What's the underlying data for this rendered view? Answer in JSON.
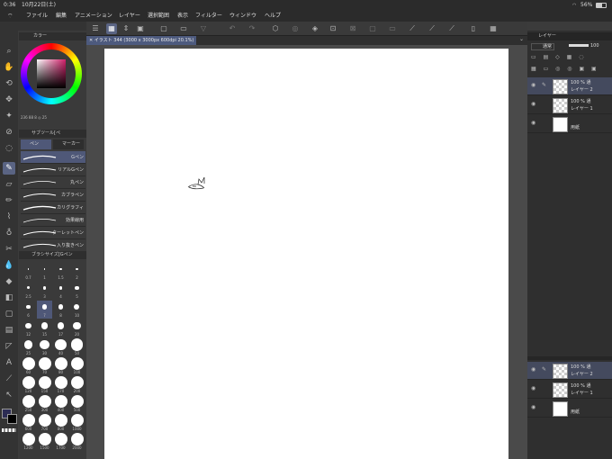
{
  "status": {
    "time": "0:36",
    "date": "10月22日(土)",
    "battery": "56%"
  },
  "menu": [
    "ファイル",
    "編集",
    "アニメーション",
    "レイヤー",
    "選択範囲",
    "表示",
    "フィルター",
    "ウィンドウ",
    "ヘルプ"
  ],
  "doc_tab": {
    "title": "イラスト 344 (3000 x 3000px 600dpi 20.1%)"
  },
  "color_panel": {
    "title": "カラー",
    "values": "236 88 8 ◎ 25"
  },
  "sub_tool": {
    "title": "サブツール[ペ",
    "tab_pen": "ペン",
    "tab_marker": "マーカー",
    "items": [
      "Gペン",
      "リアルGペン",
      "丸ペン",
      "カブラペン",
      "カリグラフィ",
      "効果線用",
      "ターレットペン",
      "入り抜きペン"
    ]
  },
  "brush_size": {
    "title": "ブラシサイズ[Gペン",
    "sizes": [
      "0.7",
      "1",
      "1.5",
      "2",
      "2.5",
      "3",
      "4",
      "5",
      "6",
      "7",
      "8",
      "10",
      "12",
      "15",
      "17",
      "20",
      "25",
      "30",
      "40",
      "50",
      "60",
      "70",
      "80",
      "100",
      "120",
      "150",
      "170",
      "200",
      "250",
      "300",
      "400",
      "500",
      "600",
      "700",
      "800",
      "1000",
      "1200",
      "1500",
      "1700",
      "2000"
    ],
    "selected": "7"
  },
  "layers_panel": {
    "title": "レイヤー",
    "blend": "通常",
    "opacity": "100"
  },
  "layers": [
    {
      "pct": "100 % 通",
      "name": "レイヤー 2",
      "selected": true
    },
    {
      "pct": "100 % 通",
      "name": "レイヤー 1",
      "selected": false
    },
    {
      "pct": "",
      "name": "用紙",
      "selected": false
    }
  ],
  "layers_bottom": [
    {
      "pct": "100 % 通",
      "name": "レイヤー 2",
      "selected": true
    },
    {
      "pct": "100 % 通",
      "name": "レイヤー 1",
      "selected": false
    },
    {
      "pct": "",
      "name": "用紙",
      "selected": false
    }
  ],
  "colors": {
    "accent": "#5a6483",
    "main_color": "#2c2c54",
    "sub_color": "#000000"
  }
}
